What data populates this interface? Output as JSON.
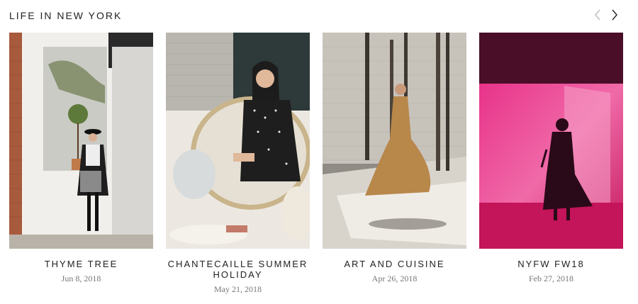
{
  "section": {
    "title": "LIFE IN NEW YORK"
  },
  "nav": {
    "prev_icon": "chevron-left-icon",
    "next_icon": "chevron-right-icon"
  },
  "posts": [
    {
      "title": "THYME TREE",
      "date": "Jun 8, 2018"
    },
    {
      "title": "CHANTECAILLE SUMMER HOLIDAY",
      "date": "May 21, 2018"
    },
    {
      "title": "ART AND CUISINE",
      "date": "Apr 26, 2018"
    },
    {
      "title": "NYFW FW18",
      "date": "Feb 27, 2018"
    }
  ],
  "colors": {
    "text": "#222222",
    "date": "#777777",
    "magenta": "#e0337f"
  }
}
